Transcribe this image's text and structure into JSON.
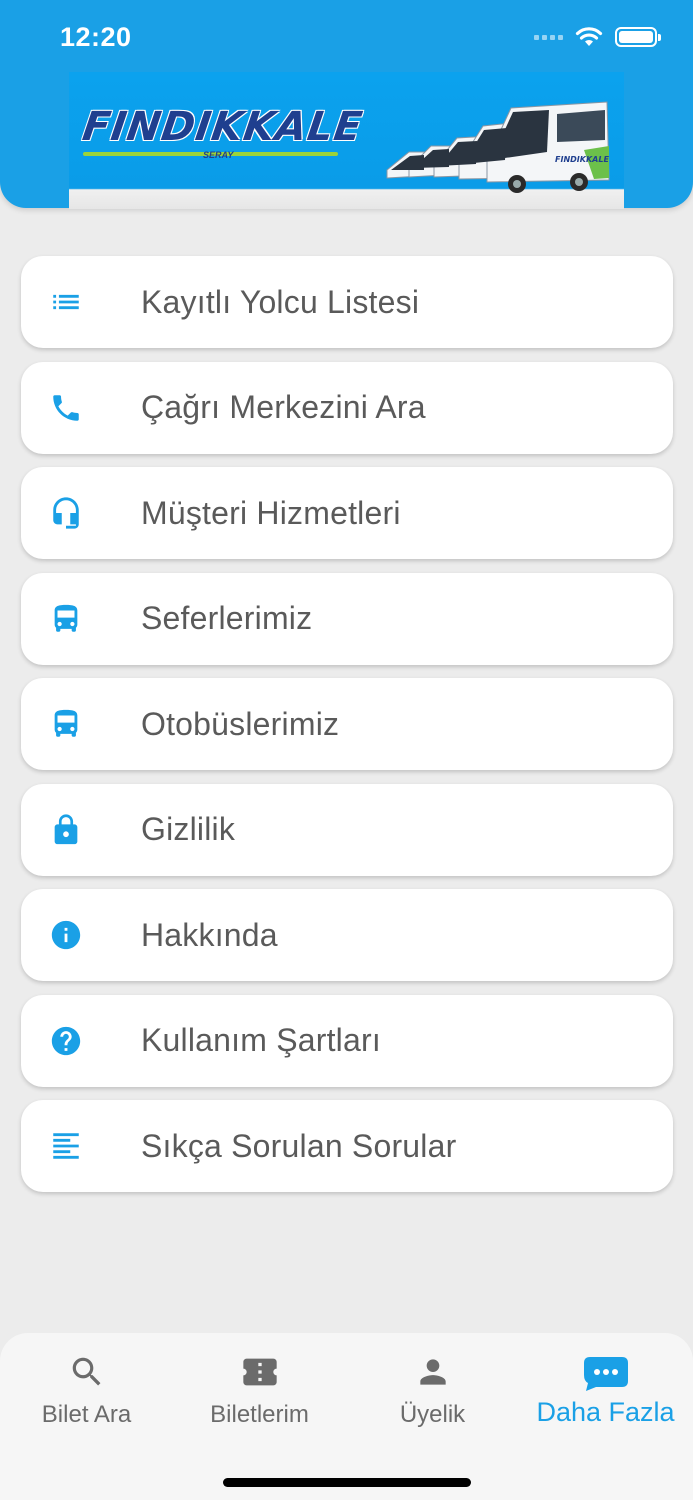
{
  "status_bar": {
    "time": "12:20"
  },
  "banner": {
    "logo_text": "FINDIKKALE",
    "logo_sub": "SERAY",
    "bus_sign": "FINDIKKALE"
  },
  "menu": {
    "items": [
      {
        "label": "Kayıtlı Yolcu Listesi",
        "icon": "list-icon"
      },
      {
        "label": "Çağrı Merkezini Ara",
        "icon": "phone-icon"
      },
      {
        "label": "Müşteri Hizmetleri",
        "icon": "headset-icon"
      },
      {
        "label": "Seferlerimiz",
        "icon": "bus-icon"
      },
      {
        "label": "Otobüslerimiz",
        "icon": "bus-icon"
      },
      {
        "label": "Gizlilik",
        "icon": "lock-icon"
      },
      {
        "label": "Hakkında",
        "icon": "info-icon"
      },
      {
        "label": "Kullanım Şartları",
        "icon": "help-icon"
      },
      {
        "label": "Sıkça Sorulan Sorular",
        "icon": "text-lines-icon"
      }
    ]
  },
  "tabbar": {
    "tabs": [
      {
        "label": "Bilet Ara",
        "icon": "search-icon"
      },
      {
        "label": "Biletlerim",
        "icon": "ticket-icon"
      },
      {
        "label": "Üyelik",
        "icon": "person-icon"
      },
      {
        "label": "Daha Fazla",
        "icon": "more-chat-icon",
        "active": true
      }
    ]
  },
  "colors": {
    "accent": "#1aa0e6",
    "background": "#ececec",
    "label": "#5a5a5a"
  }
}
